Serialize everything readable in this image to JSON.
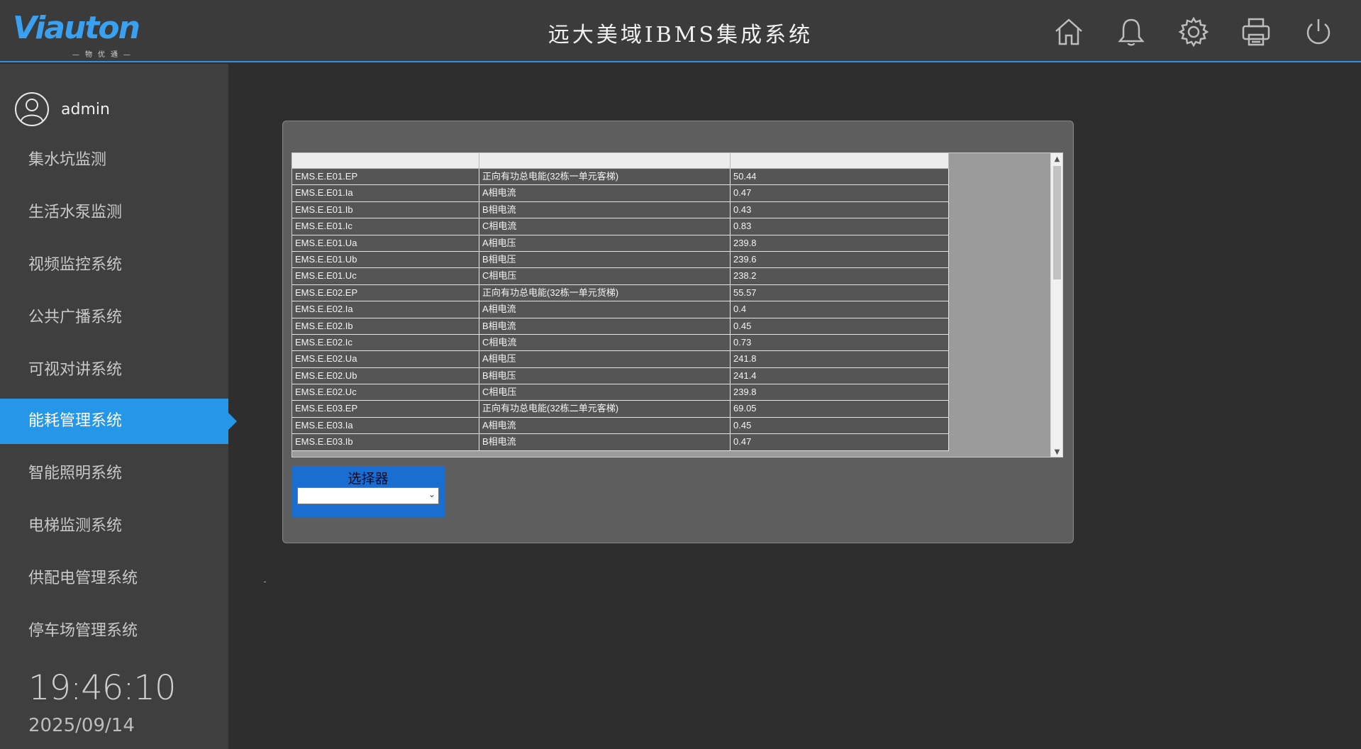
{
  "header": {
    "logo_text": "Viauton",
    "logo_sub": "—物优通—",
    "title": "远大美域IBMS集成系统",
    "icons": [
      "home-icon",
      "bell-icon",
      "gear-icon",
      "printer-icon",
      "power-icon"
    ]
  },
  "sidebar": {
    "user": "admin",
    "items": [
      {
        "label": "集水坑监测"
      },
      {
        "label": "生活水泵监测"
      },
      {
        "label": "视频监控系统"
      },
      {
        "label": "公共广播系统"
      },
      {
        "label": "可视对讲系统"
      },
      {
        "label": "能耗管理系统"
      },
      {
        "label": "智能照明系统"
      },
      {
        "label": "电梯监测系统"
      },
      {
        "label": "供配电管理系统"
      },
      {
        "label": "停车场管理系统"
      }
    ],
    "active_index": 5,
    "time": "19:46:10",
    "date": "2025/09/14"
  },
  "table": {
    "rows": [
      [
        "EMS.E.E01.EP",
        "正向有功总电能(32栋一单元客梯)",
        "50.44"
      ],
      [
        "EMS.E.E01.Ia",
        "A相电流",
        "0.47"
      ],
      [
        "EMS.E.E01.Ib",
        "B相电流",
        "0.43"
      ],
      [
        "EMS.E.E01.Ic",
        "C相电流",
        "0.83"
      ],
      [
        "EMS.E.E01.Ua",
        "A相电压",
        "239.8"
      ],
      [
        "EMS.E.E01.Ub",
        "B相电压",
        "239.6"
      ],
      [
        "EMS.E.E01.Uc",
        "C相电压",
        "238.2"
      ],
      [
        "EMS.E.E02.EP",
        "正向有功总电能(32栋一单元货梯)",
        "55.57"
      ],
      [
        "EMS.E.E02.Ia",
        "A相电流",
        "0.4"
      ],
      [
        "EMS.E.E02.Ib",
        "B相电流",
        "0.45"
      ],
      [
        "EMS.E.E02.Ic",
        "C相电流",
        "0.73"
      ],
      [
        "EMS.E.E02.Ua",
        "A相电压",
        "241.8"
      ],
      [
        "EMS.E.E02.Ub",
        "B相电压",
        "241.4"
      ],
      [
        "EMS.E.E02.Uc",
        "C相电压",
        "239.8"
      ],
      [
        "EMS.E.E03.EP",
        "正向有功总电能(32栋二单元客梯)",
        "69.05"
      ],
      [
        "EMS.E.E03.Ia",
        "A相电流",
        "0.45"
      ],
      [
        "EMS.E.E03.Ib",
        "B相电流",
        "0.47"
      ]
    ]
  },
  "selector": {
    "label": "选择器",
    "value": ""
  },
  "colors": {
    "accent": "#2596e8",
    "header_border": "#2f8fe0",
    "selector_bg": "#1a6ed2"
  }
}
